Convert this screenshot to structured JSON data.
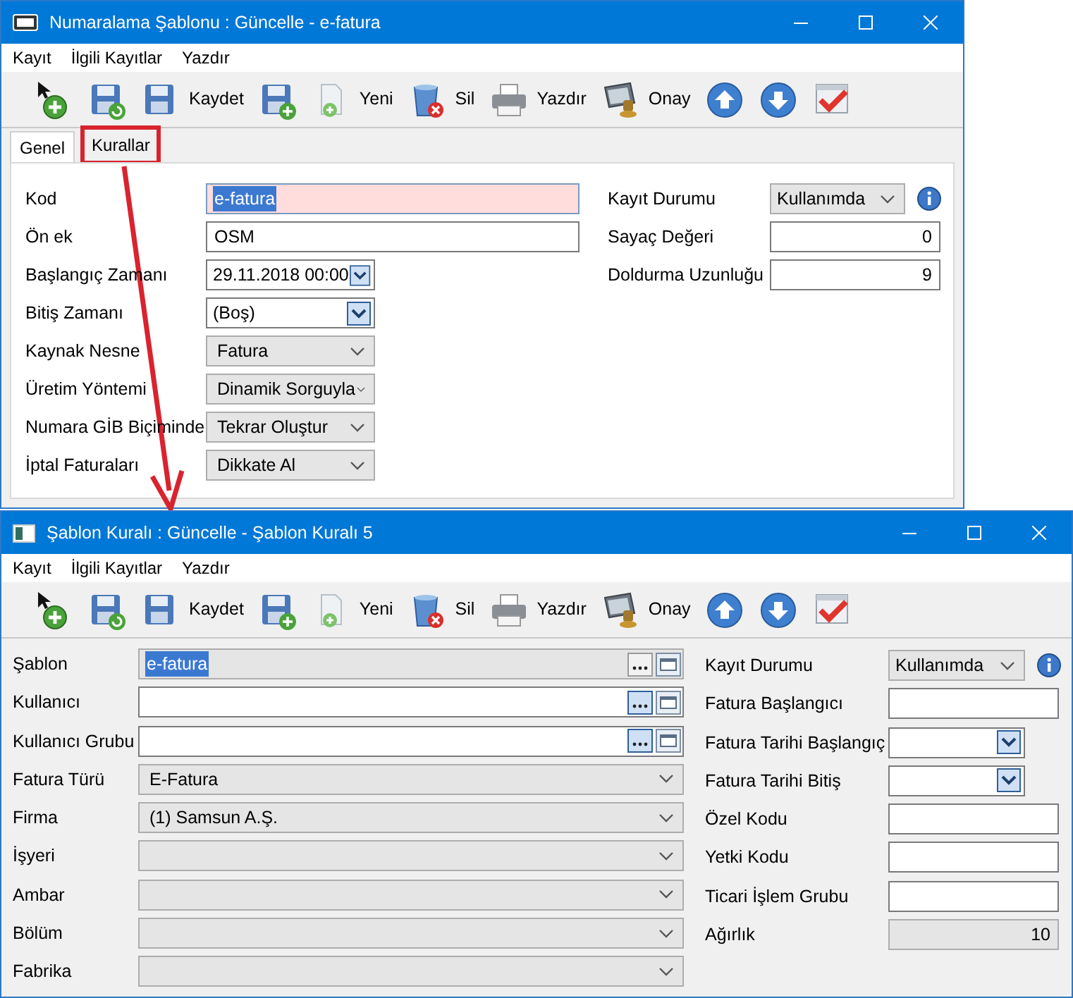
{
  "windows": [
    {
      "title": "Numaralama Şablonu : Güncelle - e-fatura",
      "menu": [
        "Kayıt",
        "İlgili Kayıtlar",
        "Yazdır"
      ],
      "toolbar": [
        {
          "kind": "add"
        },
        {
          "kind": "save-refresh"
        },
        {
          "kind": "save",
          "label": "Kaydet"
        },
        {
          "kind": "save-add"
        },
        {
          "kind": "new",
          "label": "Yeni"
        },
        {
          "kind": "delete",
          "label": "Sil"
        },
        {
          "kind": "print",
          "label": "Yazdır"
        },
        {
          "kind": "approve",
          "label": "Onay"
        },
        {
          "kind": "up"
        },
        {
          "kind": "down"
        },
        {
          "kind": "check"
        }
      ],
      "tabs": [
        {
          "label": "Genel",
          "selected": true,
          "highlighted": false
        },
        {
          "label": "Kurallar",
          "selected": false,
          "highlighted": true
        }
      ],
      "left_fields": [
        {
          "label": "Kod",
          "kind": "text",
          "value": "e-fatura",
          "error": true,
          "readonly": false,
          "text_selected": true
        },
        {
          "label": "Ön ek",
          "kind": "text",
          "value": "OSM",
          "error": false,
          "readonly": false,
          "text_selected": false
        },
        {
          "label": "Başlangıç Zamanı",
          "kind": "date",
          "value": "29.11.2018 00:00",
          "error": false,
          "readonly": false,
          "text_selected": false
        },
        {
          "label": "Bitiş Zamanı",
          "kind": "date",
          "value": "(Boş)",
          "error": false,
          "readonly": false,
          "text_selected": false
        },
        {
          "label": "Kaynak Nesne",
          "kind": "combo",
          "value": "Fatura",
          "error": false,
          "readonly": true,
          "text_selected": false
        },
        {
          "label": "Üretim Yöntemi",
          "kind": "combo",
          "value": "Dinamik Sorguyla",
          "error": false,
          "readonly": true,
          "text_selected": false
        },
        {
          "label": "Numara GİB Biçiminde",
          "kind": "combo",
          "value": "Tekrar Oluştur",
          "error": false,
          "readonly": true,
          "text_selected": false
        },
        {
          "label": "İptal Faturaları",
          "kind": "combo",
          "value": "Dikkate Al",
          "error": false,
          "readonly": true,
          "text_selected": false
        }
      ],
      "right_fields": [
        {
          "label": "Kayıt Durumu",
          "kind": "combo-info",
          "value": "Kullanımda",
          "error": false,
          "readonly": true,
          "text_selected": false
        },
        {
          "label": "Sayaç Değeri",
          "kind": "number",
          "value": "0",
          "error": false,
          "readonly": false,
          "text_selected": false
        },
        {
          "label": "Doldurma Uzunluğu",
          "kind": "number",
          "value": "9",
          "error": false,
          "readonly": false,
          "text_selected": false
        }
      ]
    },
    {
      "title": "Şablon Kuralı : Güncelle - Şablon Kuralı 5",
      "menu": [
        "Kayıt",
        "İlgili Kayıtlar",
        "Yazdır"
      ],
      "toolbar": [
        {
          "kind": "add"
        },
        {
          "kind": "save-refresh"
        },
        {
          "kind": "save",
          "label": "Kaydet"
        },
        {
          "kind": "save-add"
        },
        {
          "kind": "new",
          "label": "Yeni"
        },
        {
          "kind": "delete",
          "label": "Sil"
        },
        {
          "kind": "print",
          "label": "Yazdır"
        },
        {
          "kind": "approve",
          "label": "Onay"
        },
        {
          "kind": "up"
        },
        {
          "kind": "down"
        },
        {
          "kind": "check"
        }
      ],
      "left_fields": [
        {
          "label": "Şablon",
          "kind": "lookup",
          "value": "e-fatura",
          "error": false,
          "readonly": true,
          "text_selected": true,
          "browse_enabled": false
        },
        {
          "label": "Kullanıcı",
          "kind": "lookup",
          "error": false,
          "readonly": false,
          "browse_enabled": true
        },
        {
          "label": "Kullanıcı Grubu",
          "kind": "lookup",
          "error": false,
          "readonly": false,
          "browse_enabled": true
        },
        {
          "label": "Fatura Türü",
          "kind": "combo",
          "value": "E-Fatura",
          "error": false,
          "readonly": true,
          "text_selected": false
        },
        {
          "label": "Firma",
          "kind": "combo",
          "value": "(1) Samsun A.Ş.",
          "error": false,
          "readonly": true,
          "text_selected": false
        },
        {
          "label": "İşyeri",
          "kind": "combo",
          "error": false,
          "readonly": true
        },
        {
          "label": "Ambar",
          "kind": "combo",
          "error": false,
          "readonly": true
        },
        {
          "label": "Bölüm",
          "kind": "combo",
          "error": false,
          "readonly": true
        },
        {
          "label": "Fabrika",
          "kind": "combo",
          "error": false,
          "readonly": true
        }
      ],
      "right_fields": [
        {
          "label": "Kayıt Durumu",
          "kind": "combo-info",
          "value": "Kullanımda",
          "error": false,
          "readonly": true,
          "text_selected": false
        },
        {
          "label": "Fatura Başlangıcı",
          "kind": "text",
          "error": false,
          "readonly": false
        },
        {
          "label": "Fatura Tarihi Başlangıç",
          "kind": "date",
          "error": false,
          "readonly": false
        },
        {
          "label": "Fatura Tarihi Bitiş",
          "kind": "date",
          "error": false,
          "readonly": false
        },
        {
          "label": "Özel Kodu",
          "kind": "text",
          "error": false,
          "readonly": false
        },
        {
          "label": "Yetki Kodu",
          "kind": "text",
          "error": false,
          "readonly": false
        },
        {
          "label": "Ticari İşlem Grubu",
          "kind": "text",
          "error": false,
          "readonly": false
        },
        {
          "label": "Ağırlık",
          "kind": "number",
          "value": "10",
          "error": false,
          "readonly": true,
          "text_selected": false
        }
      ]
    }
  ]
}
